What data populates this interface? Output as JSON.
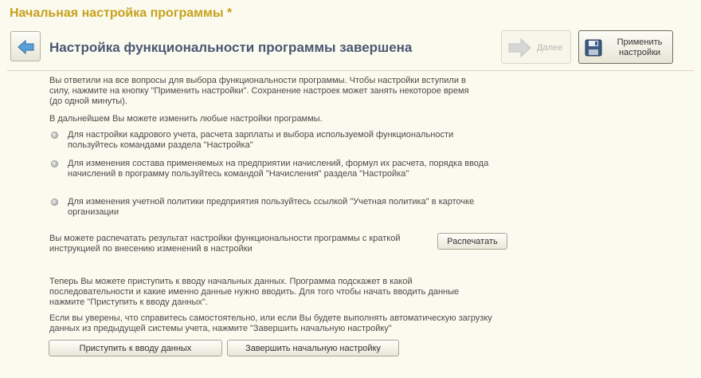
{
  "window": {
    "title": "Начальная настройка программы *"
  },
  "header": {
    "heading": "Настройка функциональности программы завершена",
    "back_icon": "arrow-left-icon",
    "next_label": "Далее",
    "next_icon": "arrow-right-icon",
    "apply_label": "Применить настройки",
    "apply_icon": "floppy-disk-icon"
  },
  "content": {
    "intro": "Вы ответили на все вопросы для выбора функциональности программы. Чтобы настройки вступили в силу, нажмите на кнопку \"Применить настройки\". Сохранение настроек может занять некоторое время (до одной минуты).",
    "later": "В дальнейшем Вы можете изменить любые настройки программы.",
    "bullets": [
      "Для настройки кадрового учета, расчета зарплаты и выбора используемой функциональности пользуйтесь командами раздела \"Настройка\"",
      "Для изменения состава применяемых на предприятии начислений, формул их расчета, порядка ввода начислений в программу пользуйтесь командой \"Начисления\" раздела \"Настройка\"",
      "Для изменения учетной политики предприятия пользуйтесь ссылкой \"Учетная политика\" в карточке организации"
    ],
    "print_text": "Вы можете распечатать результат настройки функциональности программы с краткой инструкцией по внесению изменений в настройки",
    "print_button": "Распечатать",
    "next_steps": "Теперь Вы можете приступить к вводу начальных данных. Программа подскажет в какой последовательности и какие именно данные нужно вводить. Для того чтобы начать вводить данные нажмите \"Приступить к вводу данных\".",
    "finish_text": "Если вы уверены, что справитесь самостоятельно, или если Вы будете выполнять автоматическую загрузку данных из предыдущей системы учета, нажмите \"Завершить начальную настройку\"",
    "start_button": "Приступить к вводу данных",
    "finish_button": "Завершить начальную настройку"
  },
  "colors": {
    "background": "#fbfaee",
    "title": "#c7a11d",
    "heading": "#4a5873",
    "text": "#4a4a4a"
  }
}
